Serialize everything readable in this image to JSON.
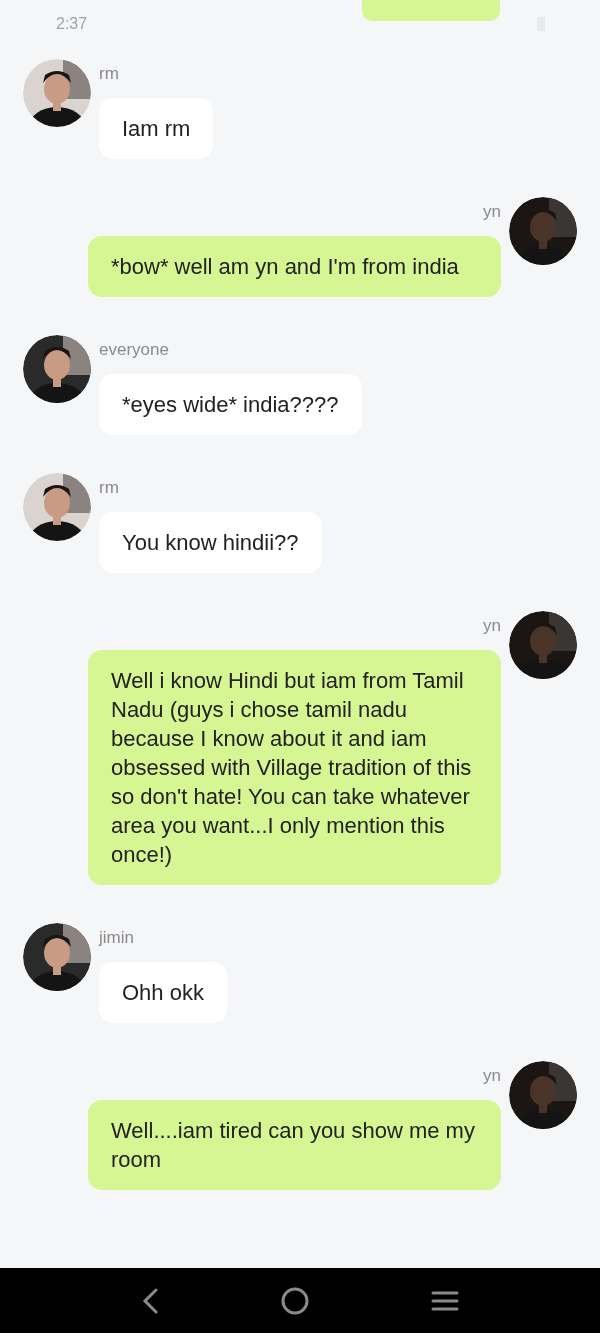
{
  "status_bar": {
    "time": "2:37"
  },
  "messages": [
    {
      "kind": "in",
      "sender": "rm",
      "text": "Iam rm"
    },
    {
      "kind": "out",
      "sender": "yn",
      "text": "*bow* well am yn and I'm from india"
    },
    {
      "kind": "in",
      "sender": "everyone",
      "text": "*eyes wide* india????"
    },
    {
      "kind": "in",
      "sender": "rm",
      "text": "You know hindii??"
    },
    {
      "kind": "out",
      "sender": "yn",
      "text": "Well i know Hindi but iam from Tamil Nadu (guys i chose tamil nadu because I know about it and iam obsessed with Village tradition of this so don't hate! You can take whatever area you want...I only mention this once!)"
    },
    {
      "kind": "in",
      "sender": "jimin",
      "text": "Ohh okk"
    },
    {
      "kind": "out",
      "sender": "yn",
      "text": "Well....iam tired can you show me my room"
    }
  ]
}
